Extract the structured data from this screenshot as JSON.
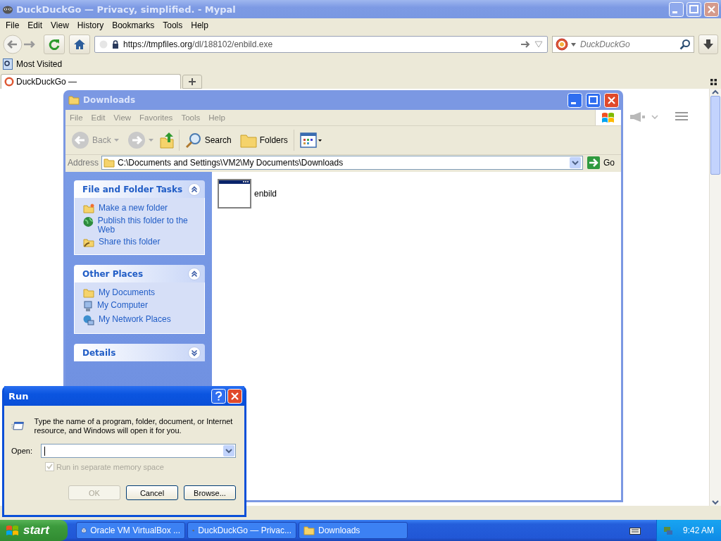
{
  "browser": {
    "title": "DuckDuckGo — Privacy, simplified. - Mypal",
    "menu": [
      "File",
      "Edit",
      "View",
      "History",
      "Bookmarks",
      "Tools",
      "Help"
    ],
    "url": {
      "host": "https://tmpfiles.org",
      "path": "/dl/188102/enbild.exe"
    },
    "search": {
      "placeholder": "DuckDuckGo"
    },
    "bookmarks": [
      "Most Visited"
    ],
    "tab": {
      "label": "DuckDuckGo —"
    }
  },
  "explorer": {
    "title": "Downloads",
    "menu": [
      "File",
      "Edit",
      "View",
      "Favorites",
      "Tools",
      "Help"
    ],
    "toolbar": {
      "back": "Back",
      "search": "Search",
      "folders": "Folders"
    },
    "address": {
      "label": "Address",
      "path": "C:\\Documents and Settings\\VM2\\My Documents\\Downloads",
      "go": "Go"
    },
    "panels": [
      {
        "title": "File and Folder Tasks",
        "expanded": true,
        "items": [
          {
            "label": "Make a new folder",
            "kind": "newfolder"
          },
          {
            "label": "Publish this folder to the Web",
            "kind": "globe"
          },
          {
            "label": "Share this folder",
            "kind": "share"
          }
        ]
      },
      {
        "title": "Other Places",
        "expanded": true,
        "items": [
          {
            "label": "My Documents",
            "kind": "folder"
          },
          {
            "label": "My Computer",
            "kind": "computer"
          },
          {
            "label": "My Network Places",
            "kind": "network"
          }
        ]
      },
      {
        "title": "Details",
        "expanded": false
      }
    ],
    "files": [
      {
        "name": "enbild"
      }
    ]
  },
  "run": {
    "title": "Run",
    "description": "Type the name of a program, folder, document, or Internet resource, and Windows will open it for you.",
    "open_label": "Open:",
    "option": {
      "label": "Run in separate memory space",
      "checked": true,
      "disabled": true
    },
    "buttons": [
      {
        "label": "OK",
        "disabled": true
      },
      {
        "label": "Cancel",
        "disabled": false
      },
      {
        "label": "Browse...",
        "disabled": false
      }
    ]
  },
  "taskbar": {
    "start": "start",
    "tasks": [
      {
        "label": "Oracle VM VirtualBox ...",
        "kind": "virtualbox"
      },
      {
        "label": "DuckDuckGo — Privac...",
        "kind": "browser"
      },
      {
        "label": "Downloads",
        "kind": "folder"
      }
    ],
    "clock": "9:42 AM"
  }
}
